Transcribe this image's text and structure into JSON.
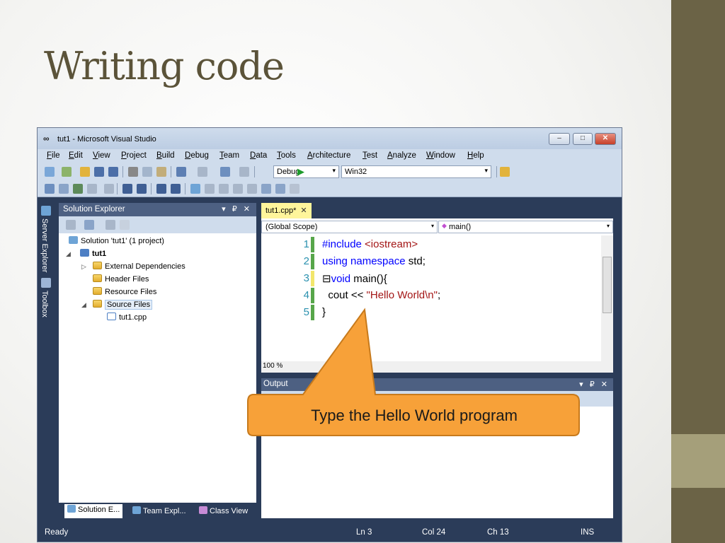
{
  "slide": {
    "title": "Writing code"
  },
  "window": {
    "title": "tut1 - Microsoft Visual Studio",
    "controls": {
      "minimize": "–",
      "maximize": "□",
      "close": "✕"
    }
  },
  "menu": [
    "File",
    "Edit",
    "View",
    "Project",
    "Build",
    "Debug",
    "Team",
    "Data",
    "Tools",
    "Architecture",
    "Test",
    "Analyze",
    "Window",
    "Help"
  ],
  "toolbar": {
    "config": "Debug",
    "platform": "Win32"
  },
  "vertical_tabs": {
    "server_explorer": "Server Explorer",
    "toolbox": "Toolbox"
  },
  "solution_explorer": {
    "title": "Solution Explorer",
    "controls": "▾ ₽ ✕",
    "tree": {
      "solution": "Solution 'tut1' (1 project)",
      "project": "tut1",
      "external_deps": "External Dependencies",
      "header_files": "Header Files",
      "resource_files": "Resource Files",
      "source_files": "Source Files",
      "file": "tut1.cpp"
    },
    "bottom_tabs": [
      "Solution E...",
      "Team Expl...",
      "Class View"
    ]
  },
  "editor": {
    "tab": "tut1.cpp*",
    "tab_close": "✕",
    "scope": "(Global Scope)",
    "member": "main()",
    "zoom": "100 %",
    "lines": [
      {
        "n": "1",
        "tokens": [
          [
            "kw",
            "#include "
          ],
          [
            "str",
            "<iostream>"
          ]
        ]
      },
      {
        "n": "2",
        "tokens": [
          [
            "kw",
            "using namespace"
          ],
          [
            "",
            " std;"
          ]
        ]
      },
      {
        "n": "3",
        "tokens": [
          [
            "",
            "⊟"
          ],
          [
            "kw",
            "void"
          ],
          [
            "",
            " main(){"
          ]
        ]
      },
      {
        "n": "4",
        "tokens": [
          [
            "",
            "  cout << "
          ],
          [
            "str",
            "\"Hello World\\n\""
          ],
          [
            "",
            ";"
          ]
        ]
      },
      {
        "n": "5",
        "tokens": [
          [
            "",
            "}"
          ]
        ]
      }
    ]
  },
  "output": {
    "title": "Output",
    "controls": "▾ ₽ ✕"
  },
  "status": {
    "ready": "Ready",
    "ln": "Ln 3",
    "col": "Col 24",
    "ch": "Ch 13",
    "ins": "INS"
  },
  "callout": {
    "text": "Type the Hello World program"
  },
  "colors": {
    "accent_dark": "#6b6346",
    "accent_light": "#a59f7a",
    "title": "#5b5339",
    "callout_fill": "#f7a139",
    "callout_stroke": "#c77a1c"
  }
}
